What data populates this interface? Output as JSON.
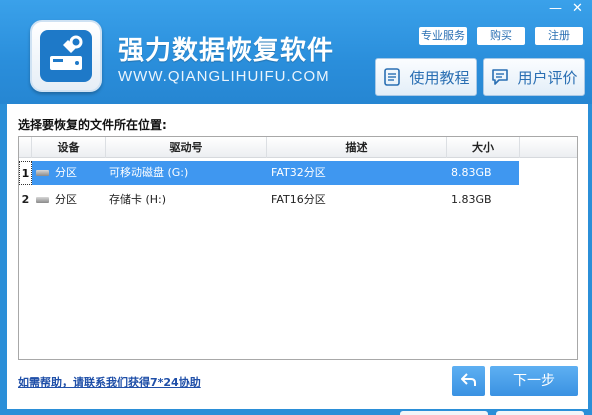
{
  "app": {
    "title": "强力数据恢复软件",
    "url": "WWW.QIANGLIHUIFU.COM"
  },
  "top_links": {
    "pro_service": "专业服务",
    "buy": "购买",
    "register": "注册"
  },
  "window_controls": {
    "minimize": "—",
    "close": "✕"
  },
  "header_buttons": {
    "tutorial": "使用教程",
    "reviews": "用户评价"
  },
  "main": {
    "prompt": "选择要恢复的文件所在位置:"
  },
  "table": {
    "columns": [
      "设备",
      "驱动号",
      "描述",
      "大小"
    ],
    "rows": [
      {
        "num": "1",
        "device": "分区",
        "drive": "可移动磁盘 (G:)",
        "desc": "FAT32分区",
        "size": "8.83GB"
      },
      {
        "num": "2",
        "device": "分区",
        "drive": "存储卡 (H:)",
        "desc": "FAT16分区",
        "size": "1.83GB"
      }
    ]
  },
  "footer": {
    "help_link": "如需帮助，请联系我们获得7*24协助",
    "next": "下一步"
  },
  "colors": {
    "header_blue": "#2b8fd8",
    "selection_blue": "#3f97f0",
    "button_blue": "#3a92e2"
  },
  "icons": {
    "logo": "drive-wrench-icon",
    "tutorial": "book-icon",
    "reviews": "chat-icon",
    "device": "drive-icon",
    "back": "back-arrow-icon"
  }
}
